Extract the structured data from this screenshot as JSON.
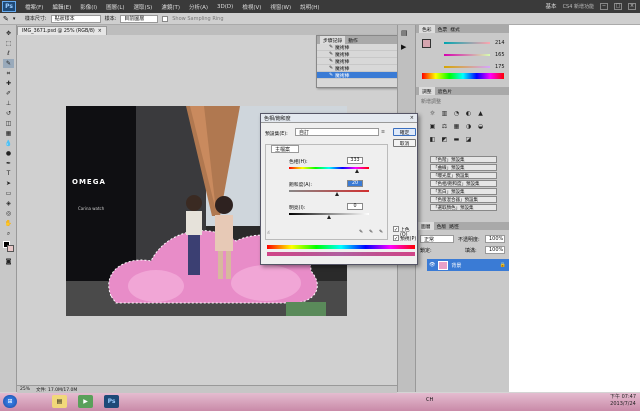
{
  "menu": {
    "logo": "Ps",
    "items": [
      "檔案(F)",
      "編輯(E)",
      "影像(I)",
      "圖層(L)",
      "選取(S)",
      "濾鏡(T)",
      "分析(A)",
      "3D(D)",
      "檢視(V)",
      "視窗(W)",
      "說明(H)"
    ],
    "workspace": "基本",
    "cs_live": "CS4 新增功能",
    "window_controls": [
      "−",
      "□",
      "×"
    ]
  },
  "options": {
    "tool_icon": "magic-wand-icon",
    "sample_label": "樣本尺寸:",
    "sample_value": "點狀樣本",
    "sample2_label": "樣本:",
    "sample2_value": "目前圖層",
    "show_ring": "Show Sampling Ring"
  },
  "document": {
    "tab_title": "IMG_3671.psd @ 25% (RGB/8)",
    "tab_close": "×",
    "zoom": "25%",
    "file_info": "文件: 17.0M/17.0M",
    "photo_sign": "OMEGA",
    "photo_sub": "Carina watch"
  },
  "history": {
    "tabs": [
      "步驟記錄",
      "動作"
    ],
    "rows": [
      "魔術棒",
      "魔術棒",
      "魔術棒",
      "魔術棒",
      "魔術棒"
    ],
    "selected_index": 4
  },
  "dialog": {
    "title": "色相/飽和度",
    "close": "×",
    "preset_label": "預設集(E):",
    "preset_value": "自訂",
    "range": "主檔案",
    "hue_label": "色相(H):",
    "hue_value": "333",
    "sat_label": "飽和度(A):",
    "sat_value": "20",
    "light_label": "明亮(I):",
    "light_value": "0",
    "ok": "確定",
    "cancel": "取消",
    "colorize": "上色(O)",
    "preview": "預視(P)",
    "colorize_checked": true,
    "preview_checked": true
  },
  "color_panel": {
    "tabs": [
      "色彩",
      "色票",
      "樣式"
    ],
    "values": [
      "214",
      "165",
      "175"
    ]
  },
  "adjustments": {
    "tabs": [
      "調整",
      "遮色片"
    ],
    "subtitle": "新增調整",
    "icons_row1": [
      "☼",
      "▥",
      "◔",
      "◐",
      "▲"
    ],
    "icons_row2": [
      "▣",
      "⚖",
      "▦",
      "◑",
      "◒"
    ],
    "icons_row3": [
      "◧",
      "◩",
      "▬",
      "◪"
    ],
    "presets": [
      "「色階」預設集",
      "「曲線」預設集",
      "「曝光度」預設集",
      "「色相/飽和度」預設集",
      "「黑白」預設集",
      "「色版混合器」預設集",
      "「選取顏色」預設集"
    ]
  },
  "layers": {
    "tabs": [
      "圖層",
      "色版",
      "路徑"
    ],
    "blend": "正常",
    "opacity_label": "不透明度:",
    "opacity": "100%",
    "lock_label": "鎖定:",
    "fill_label": "填滿:",
    "fill": "100%",
    "layer_name": "背景"
  },
  "taskbar": {
    "lang": "CH",
    "time": "下午 07:47",
    "date": "2013/7/24"
  },
  "colors": {
    "selection": "#3a7bd5",
    "taskbar": "#d19bb6"
  }
}
